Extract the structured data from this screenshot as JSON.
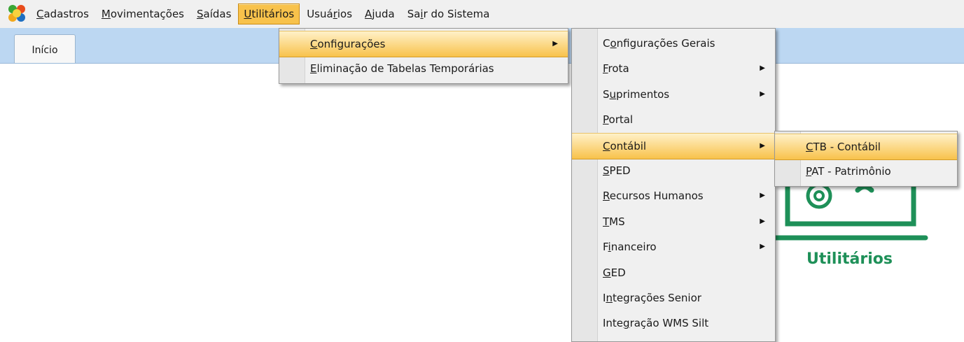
{
  "menubar": {
    "items": [
      {
        "label": "Cadastros",
        "underline": "C"
      },
      {
        "label": "Movimentações",
        "underline": "M"
      },
      {
        "label": "Saídas",
        "underline": "S"
      },
      {
        "label": "Utilitários",
        "underline": "U",
        "active": true
      },
      {
        "label": "Usuários",
        "underline": "r"
      },
      {
        "label": "Ajuda",
        "underline": "A"
      },
      {
        "label": "Sair do Sistema",
        "underline": "i"
      }
    ]
  },
  "tabs": [
    {
      "label": "Início"
    }
  ],
  "menus": {
    "utilitarios": [
      {
        "label": "Configurações",
        "underline": "C",
        "submenu": true,
        "highlighted": true
      },
      {
        "label": "Eliminação de Tabelas Temporárias",
        "underline": "E",
        "submenu": false
      }
    ],
    "configuracoes": [
      {
        "label": "Configurações Gerais",
        "underline": "o",
        "submenu": false
      },
      {
        "label": "Frota",
        "underline": "F",
        "submenu": true
      },
      {
        "label": "Suprimentos",
        "underline": "u",
        "submenu": true
      },
      {
        "label": "Portal",
        "underline": "P",
        "submenu": false
      },
      {
        "label": "Contábil",
        "underline": "C",
        "submenu": true,
        "highlighted": true
      },
      {
        "label": "SPED",
        "underline": "S",
        "submenu": false
      },
      {
        "label": "Recursos Humanos",
        "underline": "R",
        "submenu": true
      },
      {
        "label": "TMS",
        "underline": "T",
        "submenu": true
      },
      {
        "label": "Financeiro",
        "underline": "i",
        "submenu": true
      },
      {
        "label": "GED",
        "underline": "G",
        "submenu": false
      },
      {
        "label": "Integrações Senior",
        "underline": "n",
        "submenu": false
      },
      {
        "label": "Integração WMS Silt",
        "underline": "g",
        "submenu": false
      }
    ],
    "contabil": [
      {
        "label": "CTB - Contábil",
        "underline": "C",
        "submenu": false,
        "highlighted": true
      },
      {
        "label": "PAT - Patrimônio",
        "underline": "P",
        "submenu": false
      }
    ]
  },
  "background": {
    "label": "Utilitários"
  },
  "colors": {
    "menu_highlight": "#f8c24b",
    "tabstrip": "#bcd7f2",
    "accent_green": "#1e9058"
  }
}
